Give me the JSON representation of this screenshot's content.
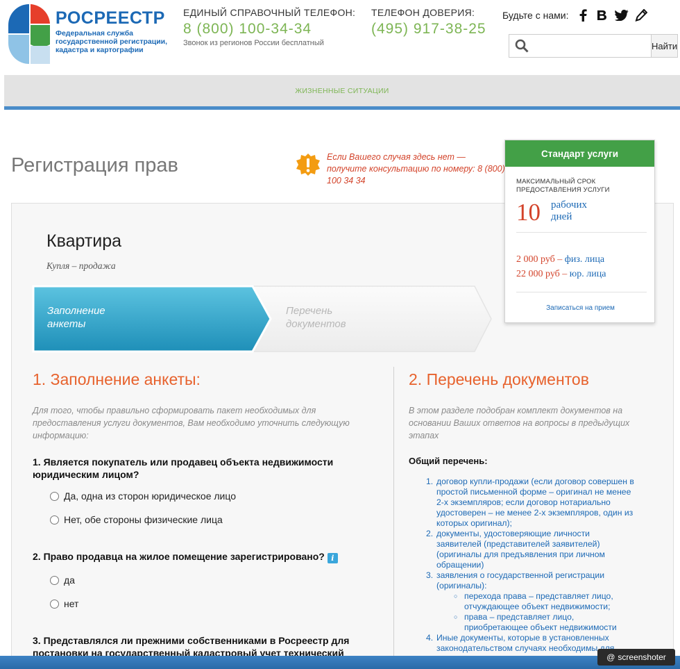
{
  "header": {
    "logo_name": "РОСРЕЕСТР",
    "logo_sub": "Федеральная служба государственной регистрации, кадастра и картографии",
    "phone1": {
      "label": "ЕДИНЫЙ СПРАВОЧНЫЙ ТЕЛЕФОН:",
      "number": "8 (800) 100-34-34",
      "note": "Звонок из регионов России бесплатный"
    },
    "phone2": {
      "label": "ТЕЛЕФОН ДОВЕРИЯ:",
      "number": "(495) 917-38-25"
    },
    "social_label": "Будьте с нами:",
    "social_icons": [
      "facebook-icon",
      "vkontakte-icon",
      "twitter-icon",
      "blog-pen-icon"
    ],
    "search": {
      "value": "",
      "button": "Найти",
      "icon": "search-icon"
    }
  },
  "nav": {
    "item": "ЖИЗНЕННЫЕ СИТУАЦИИ"
  },
  "page": {
    "title": "Регистрация прав",
    "warning": "Если Вашего случая здесь нет — получите консультацию по номеру: 8 (800) 100 34 34"
  },
  "object": {
    "title": "Квартира",
    "subtitle": "Купля – продажа"
  },
  "steps": [
    {
      "label_line1": "Заполнение",
      "label_line2": "анкеты",
      "active": true
    },
    {
      "label_line1": "Перечень",
      "label_line2": "документов",
      "active": false
    }
  ],
  "left": {
    "title": "1. Заполнение анкеты:",
    "intro": "Для того, чтобы правильно сформировать пакет необходимых для предоставления услуги документов, Вам необходимо уточнить следующую информацию:",
    "q1": {
      "text": "1. Является покупатель или продавец объекта недвижимости юридическим лицом?",
      "options": [
        "Да, одна из сторон юридическое лицо",
        "Нет, обе стороны физические лица"
      ]
    },
    "q2": {
      "text": "2. Право продавца на жилое помещение зарегистрировано?",
      "info": "i",
      "options": [
        "да",
        "нет"
      ]
    },
    "q3": {
      "text": "3. Представлялся ли прежними собственниками в Росреестр для постановки на государственный кадастровый учет технический"
    }
  },
  "right": {
    "title": "2. Перечень документов",
    "intro": "В этом разделе подобран комплект документов на основании Ваших ответов на вопросы в предыдущих этапах",
    "list_head": "Общий перечень:",
    "items": [
      {
        "num": "1.",
        "text": "договор купли-продажи (если договор совершен в простой письменной форме – оригинал не менее 2-х экземпляров; если договор нотариально удостоверен – не менее 2-х экземпляров, один из которых оригинал);"
      },
      {
        "num": "2.",
        "text": "документы, удостоверяющие личности заявителей (представителей заявителей) (оригиналы для предъявления при личном обращении)"
      },
      {
        "num": "3.",
        "text": "заявления о государственной регистрации (оригиналы):"
      },
      {
        "num": "4.",
        "text": "Иные документы, которые в установленных законодательством случаях необходимы для"
      }
    ],
    "subitems": [
      "перехода права – представляет лицо, отчуждающее объект недвижимости;",
      "права – представляет лицо, приобретающее объект недвижимости"
    ]
  },
  "card": {
    "title": "Стандарт услуги",
    "label": "МАКСИМАЛЬНЫЙ СРОК ПРЕДОСТАВЛЕНИЯ УСЛУГИ",
    "days": "10",
    "unit_line1": "рабочих",
    "unit_line2": "дней",
    "price1": {
      "value": "2 000 руб –",
      "who": "физ. лица"
    },
    "price2": {
      "value": "22 000 руб –",
      "who": "юр. лица"
    },
    "link": "Записаться на прием"
  },
  "watermark": "screenshoter",
  "colors": {
    "brand_blue": "#1c69b5",
    "green": "#7db554",
    "accent_orange": "#e7622d",
    "card_green": "#43a047"
  }
}
